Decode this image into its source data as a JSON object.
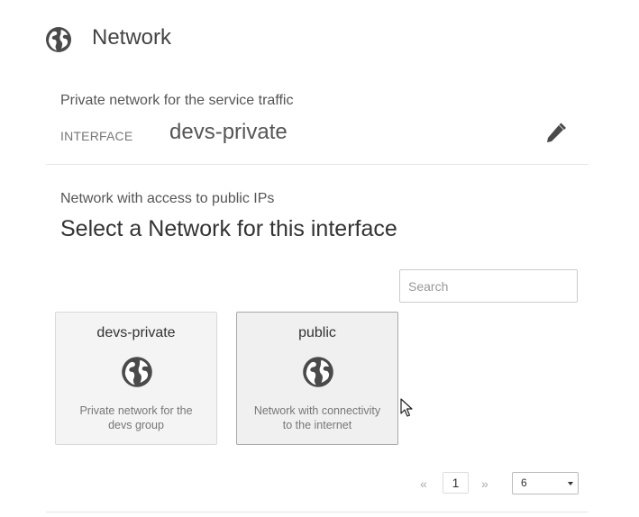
{
  "header": {
    "title": "Network",
    "icon": "globe-icon"
  },
  "private_section": {
    "description": "Private network for the service traffic",
    "interface_label": "INTERFACE",
    "interface_value": "devs-private",
    "edit_icon": "pencil-icon"
  },
  "public_section": {
    "description": "Network with access to public IPs",
    "heading": "Select a Network for this interface",
    "search": {
      "placeholder": "Search",
      "value": ""
    },
    "cards": [
      {
        "title": "devs-private",
        "icon": "globe-icon",
        "description": "Private network for the devs group",
        "selected": false
      },
      {
        "title": "public",
        "icon": "globe-icon",
        "description": "Network with connectivity to the internet",
        "selected": true
      }
    ]
  },
  "pagination": {
    "prev": "«",
    "current_page": "1",
    "next": "»",
    "page_size": "6"
  },
  "colors": {
    "icon": "#4a4a4a",
    "card_bg": "#f4f4f4",
    "border": "#d9d9d9"
  }
}
